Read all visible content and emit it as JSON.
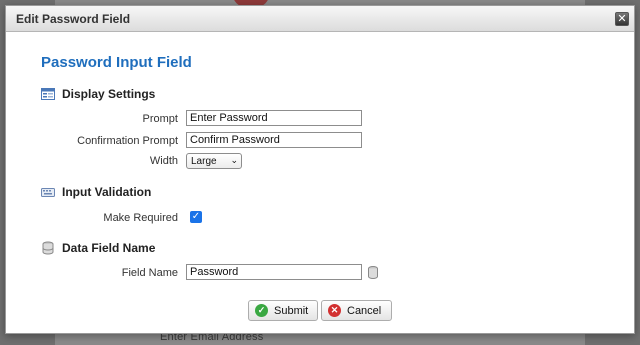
{
  "dialog": {
    "title": "Edit Password Field",
    "heading": "Password Input Field"
  },
  "display_settings": {
    "title": "Display Settings",
    "prompt_label": "Prompt",
    "prompt_value": "Enter Password",
    "confirm_label": "Confirmation Prompt",
    "confirm_value": "Confirm Password",
    "width_label": "Width",
    "width_value": "Large"
  },
  "input_validation": {
    "title": "Input Validation",
    "required_label": "Make Required",
    "required_checked": true
  },
  "data_field": {
    "title": "Data Field Name",
    "field_label": "Field Name",
    "field_value": "Password"
  },
  "buttons": {
    "submit": "Submit",
    "cancel": "Cancel"
  },
  "background": {
    "text": "Enter Email Address"
  },
  "colors": {
    "heading": "#1f6ebd",
    "checkbox": "#1a73e8",
    "submit_icon": "#3aa842",
    "cancel_icon": "#d23030"
  }
}
